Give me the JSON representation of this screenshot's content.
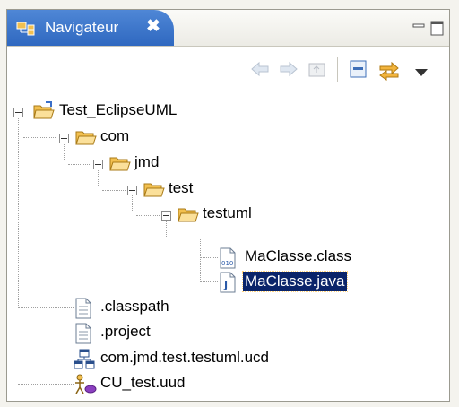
{
  "view": {
    "title": "Navigateur",
    "close_glyph": "✖"
  },
  "window_controls": {
    "minimize": "minimize-icon",
    "maximize": "maximize-icon"
  },
  "toolbar": {
    "icons": [
      "back-arrow-icon",
      "forward-arrow-icon",
      "up-folder-icon",
      "collapse-all-icon",
      "link-with-editor-icon",
      "view-menu-icon"
    ]
  },
  "tree": {
    "project": "Test_EclipseUML",
    "folders": [
      "com",
      "jmd",
      "test",
      "testuml"
    ],
    "files_in_testuml": [
      "MaClasse.class",
      "MaClasse.java"
    ],
    "project_files": [
      ".classpath",
      ".project",
      "com.jmd.test.testuml.ucd",
      "CU_test.uud"
    ],
    "selected": "MaClasse.java"
  },
  "colors": {
    "tab_blue": "#3b74cc",
    "selection": "#0a246a",
    "folder": "#f2c050"
  }
}
